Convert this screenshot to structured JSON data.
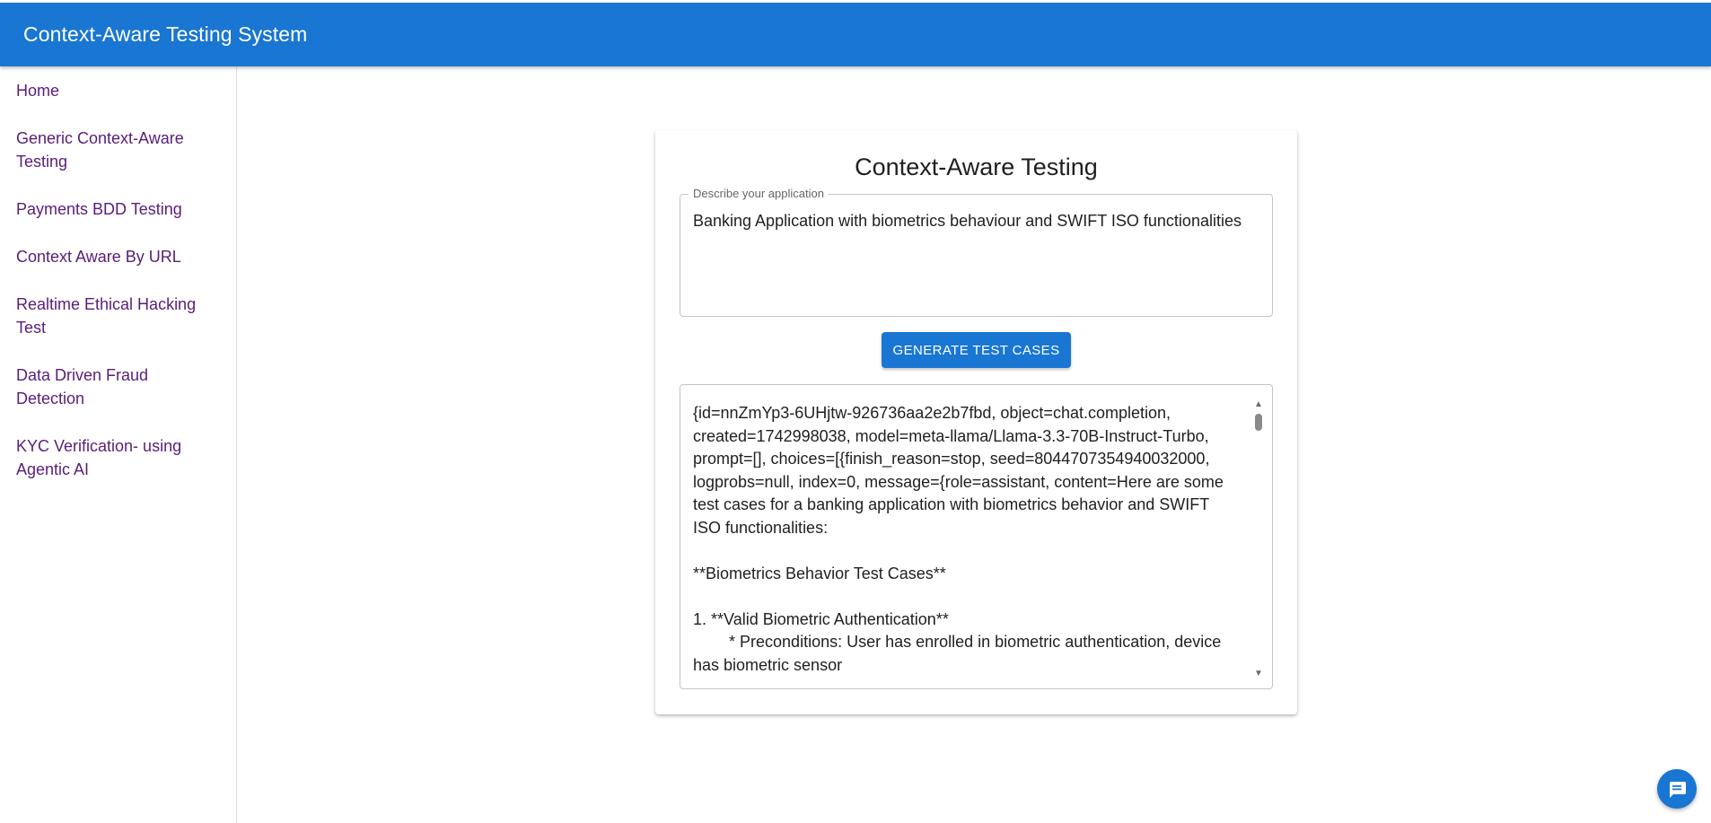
{
  "app": {
    "title": "Context-Aware Testing System"
  },
  "sidebar": {
    "items": [
      {
        "label": "Home"
      },
      {
        "label": "Generic Context-Aware Testing"
      },
      {
        "label": "Payments BDD Testing"
      },
      {
        "label": "Context Aware By URL"
      },
      {
        "label": "Realtime Ethical Hacking Test"
      },
      {
        "label": "Data Driven Fraud Detection"
      },
      {
        "label": "KYC Verification- using Agentic AI"
      }
    ],
    "link_color": "#5a1d7a"
  },
  "main": {
    "card_title": "Context-Aware Testing",
    "description": {
      "label": "Describe your application",
      "value": "Banking Application with biometrics behaviour and SWIFT ISO functionalities"
    },
    "generate_button_label": "GENERATE TEST CASES",
    "output": {
      "text": "{id=nnZmYp3-6UHjtw-926736aa2e2b7fbd, object=chat.completion, created=1742998038, model=meta-llama/Llama-3.3-70B-Instruct-Turbo, prompt=[], choices=[{finish_reason=stop, seed=8044707354940032000, logprobs=null, index=0, message={role=assistant, content=Here are some test cases for a banking application with biometrics behavior and SWIFT ISO functionalities:\n\n**Biometrics Behavior Test Cases**\n\n1. **Valid Biometric Authentication**\n\t* Preconditions: User has enrolled in biometric authentication, device has biometric sensor"
    }
  },
  "chat_fab": {
    "icon": "chat-bubble-icon"
  },
  "colors": {
    "primary": "#1976d2",
    "background": "#ffffff"
  }
}
